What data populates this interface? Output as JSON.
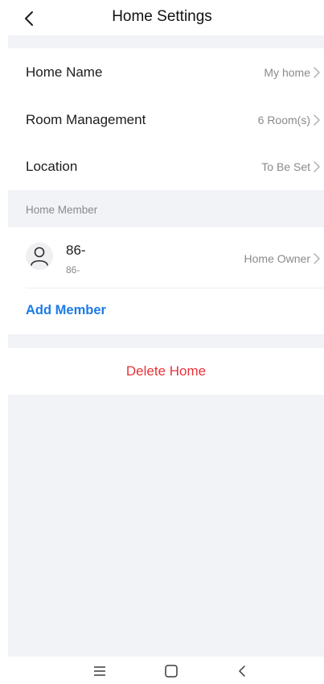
{
  "header": {
    "title": "Home Settings",
    "back_icon": "chevron-left-icon"
  },
  "settings": {
    "home_name": {
      "label": "Home Name",
      "value": "My home"
    },
    "room_management": {
      "label": "Room Management",
      "value": "6 Room(s)"
    },
    "location": {
      "label": "Location",
      "value": "To Be Set"
    }
  },
  "members_section": {
    "title": "Home Member",
    "members": [
      {
        "name": "86-",
        "sub": "86-",
        "role": "Home Owner",
        "avatar_icon": "user-icon"
      }
    ],
    "add_label": "Add Member"
  },
  "delete_label": "Delete Home",
  "system_nav": {
    "menu_icon": "menu-icon",
    "home_icon": "square-home-icon",
    "back_icon": "chevron-left-icon"
  },
  "colors": {
    "accent": "#1e7be6",
    "danger": "#e8333a",
    "background": "#f2f3f7",
    "secondary_text": "#8a8a8e"
  }
}
